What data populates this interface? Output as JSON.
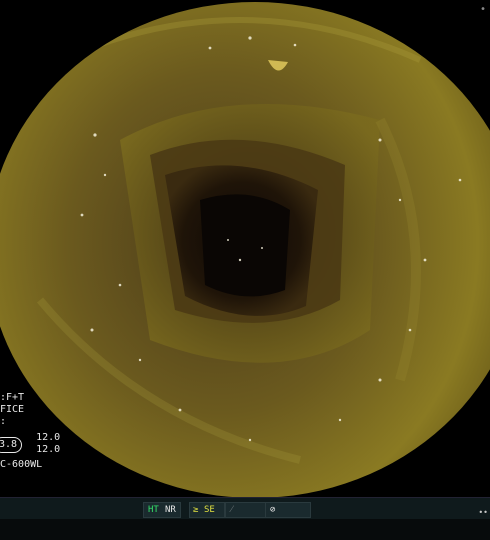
{
  "overlay": {
    "line1": ":F+T",
    "line2": "FICE",
    "line3": ":",
    "badge": "3.8",
    "value_top": "12.0",
    "value_bottom": "12.0",
    "model": "C-600WL"
  },
  "statusbar": {
    "ht": "HT",
    "nr": "NR",
    "se": "SE"
  },
  "corner_mark": "•",
  "right_mark": "••"
}
